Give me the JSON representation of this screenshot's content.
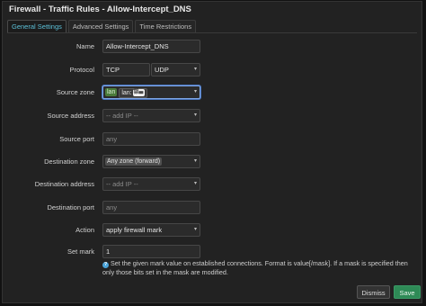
{
  "dialog": {
    "title": "Firewall - Traffic Rules - Allow-Intercept_DNS",
    "tabs": [
      "General Settings",
      "Advanced Settings",
      "Time Restrictions"
    ],
    "active_tab": "General Settings"
  },
  "form": {
    "name": {
      "label": "Name",
      "value": "Allow-Intercept_DNS"
    },
    "protocol": {
      "label": "Protocol",
      "values": [
        "TCP",
        "UDP"
      ]
    },
    "source_zone": {
      "label": "Source zone",
      "zone": "lan",
      "zone_label": "lan:",
      "networks": "⛆☰"
    },
    "source_address": {
      "label": "Source address",
      "placeholder": "-- add IP --"
    },
    "source_port": {
      "label": "Source port",
      "placeholder": "any"
    },
    "destination_zone": {
      "label": "Destination zone",
      "value": "Any zone (forward)"
    },
    "destination_address": {
      "label": "Destination address",
      "placeholder": "-- add IP --"
    },
    "destination_port": {
      "label": "Destination port",
      "placeholder": "any"
    },
    "action": {
      "label": "Action",
      "value": "apply firewall mark"
    },
    "set_mark": {
      "label": "Set mark",
      "value": "1",
      "help_icon": "?",
      "help": "Set the given mark value on established connections. Format is value[/mask]. If a mask is specified then only those bits set in the mask are modified."
    }
  },
  "footer": {
    "dismiss": "Dismiss",
    "save": "Save"
  },
  "icons": {
    "dropdown": "▾"
  },
  "colors": {
    "active_tab": "#5cc0d8",
    "save_button": "#2e8a56",
    "lan_zone": "#4a7a3a",
    "focus": "#7ea6e6"
  }
}
